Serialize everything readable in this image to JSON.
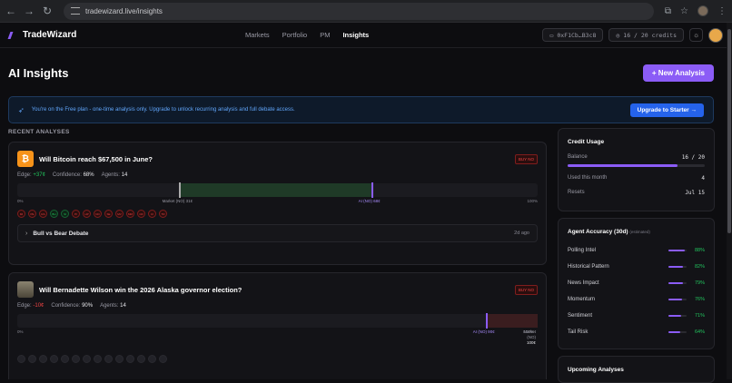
{
  "browser": {
    "url": "tradewizard.live/insights"
  },
  "app": {
    "name": "TradeWizard",
    "nav": [
      "Markets",
      "Portfolio",
      "PM",
      "Insights"
    ],
    "wallet": "0xF1Cb…B3c8",
    "credits": "16 / 20 credits"
  },
  "page": {
    "title": "AI Insights",
    "new_button": "+ New Analysis"
  },
  "banner": {
    "text": "You're on the Free plan - one-time analysis only. Upgrade to unlock recurring analysis and full debate access.",
    "button": "Upgrade to Starter →"
  },
  "recent_title": "RECENT ANALYSES",
  "analyses": [
    {
      "question": "Will Bitcoin reach $67,500 in June?",
      "badge": "BUY NO",
      "edge_label": "Edge:",
      "edge": "+37¢",
      "confidence_label": "Confidence:",
      "confidence": "68%",
      "agents_label": "Agents:",
      "agents": "14",
      "market_label": "Market (NO) 31¢",
      "ai_label": "AI (NO) 68¢",
      "scale_min": "0%",
      "scale_max": "100%",
      "market_value": 31,
      "ai_value": 68,
      "chips": [
        "MI",
        "PE",
        "RA",
        "BH",
        "SI",
        "PI",
        "HP",
        "NO",
        "SE",
        "MV",
        "MM",
        "CR",
        "CI",
        "TR"
      ],
      "debate_label": "Bull vs Bear Debate",
      "debate_ago": "2d ago"
    },
    {
      "question": "Will Bernadette Wilson win the 2026 Alaska governor election?",
      "badge": "BUY NO",
      "edge_label": "Edge:",
      "edge": "-10¢",
      "confidence_label": "Confidence:",
      "confidence": "90%",
      "agents_label": "Agents:",
      "agents": "14",
      "ai_label": "AI (NO) 90¢",
      "market_label": "100¢",
      "market_label_top": "Market",
      "market_label_mid": "(NO)",
      "scale_min": "0%",
      "scale_max": "100%",
      "market_value": 100,
      "ai_value": 90
    }
  ],
  "credit_usage": {
    "title": "Credit Usage",
    "balance_label": "Balance",
    "balance": "16 / 20",
    "balance_fraction": 0.8,
    "used_label": "Used this month",
    "used": "4",
    "resets_label": "Resets",
    "resets": "Jul 15"
  },
  "agent_accuracy": {
    "title": "Agent Accuracy (30d)",
    "note": "(estimated)",
    "rows": [
      {
        "name": "Polling Intel",
        "pct": "88%",
        "value": 88
      },
      {
        "name": "Historical Pattern",
        "pct": "82%",
        "value": 82
      },
      {
        "name": "News Impact",
        "pct": "79%",
        "value": 79
      },
      {
        "name": "Momentum",
        "pct": "76%",
        "value": 76
      },
      {
        "name": "Sentiment",
        "pct": "71%",
        "value": 71
      },
      {
        "name": "Tail Risk",
        "pct": "64%",
        "value": 64
      }
    ]
  },
  "upcoming": {
    "title": "Upcoming Analyses"
  }
}
